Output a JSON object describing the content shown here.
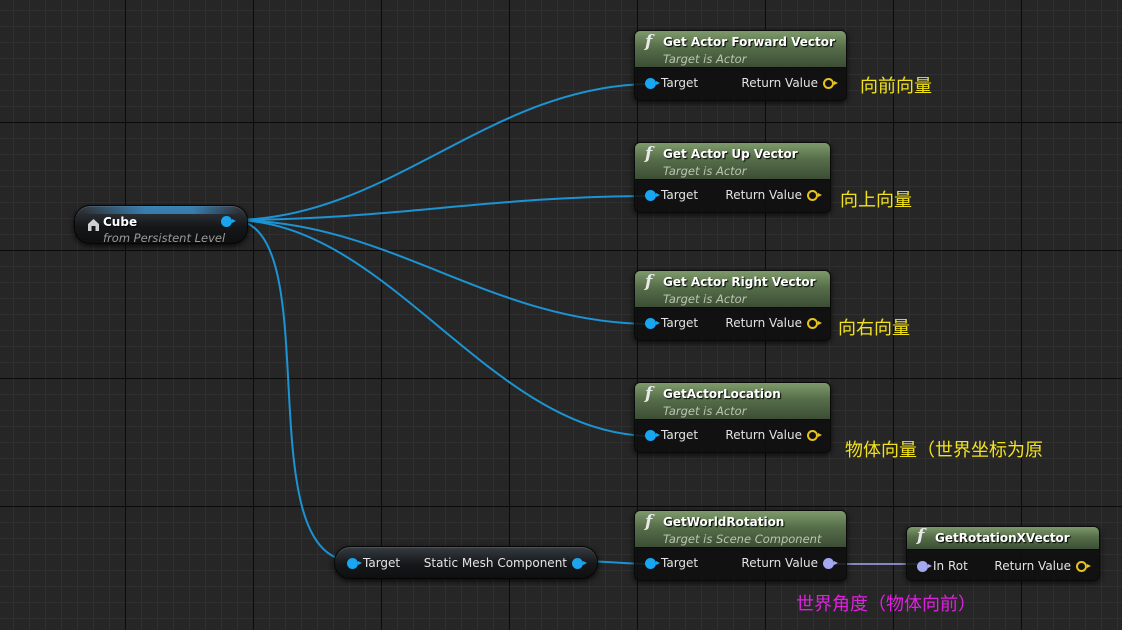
{
  "colors": {
    "object_pin": "#1aa5ee",
    "vector_pin": "#e5c322",
    "rotator_pin": "#a3a8f0",
    "function_header": "#566e49",
    "annotation_yellow": "#f2e21d",
    "annotation_magenta": "#e020e0"
  },
  "cube_node": {
    "title": "Cube",
    "subtitle": "from Persistent Level",
    "icon": "actor-reference-icon"
  },
  "get_component_node": {
    "input_label": "Target",
    "output_label": "Static Mesh Component"
  },
  "function_icon": "f",
  "nodes": [
    {
      "title": "Get Actor Forward Vector",
      "subtitle": "Target is Actor",
      "input_label": "Target",
      "output_label": "Return Value"
    },
    {
      "title": "Get Actor Up Vector",
      "subtitle": "Target is Actor",
      "input_label": "Target",
      "output_label": "Return Value"
    },
    {
      "title": "Get Actor Right Vector",
      "subtitle": "Target is Actor",
      "input_label": "Target",
      "output_label": "Return Value"
    },
    {
      "title": "GetActorLocation",
      "subtitle": "Target is Actor",
      "input_label": "Target",
      "output_label": "Return Value"
    },
    {
      "title": "GetWorldRotation",
      "subtitle": "Target is Scene Component",
      "input_label": "Target",
      "output_label": "Return Value"
    },
    {
      "title": "GetRotationXVector",
      "subtitle": "",
      "input_label": "In Rot",
      "output_label": "Return Value"
    }
  ],
  "annotations": [
    "向前向量",
    "向上向量",
    "向右向量",
    "物体向量（世界坐标为原",
    "世界角度（物体向前）"
  ]
}
